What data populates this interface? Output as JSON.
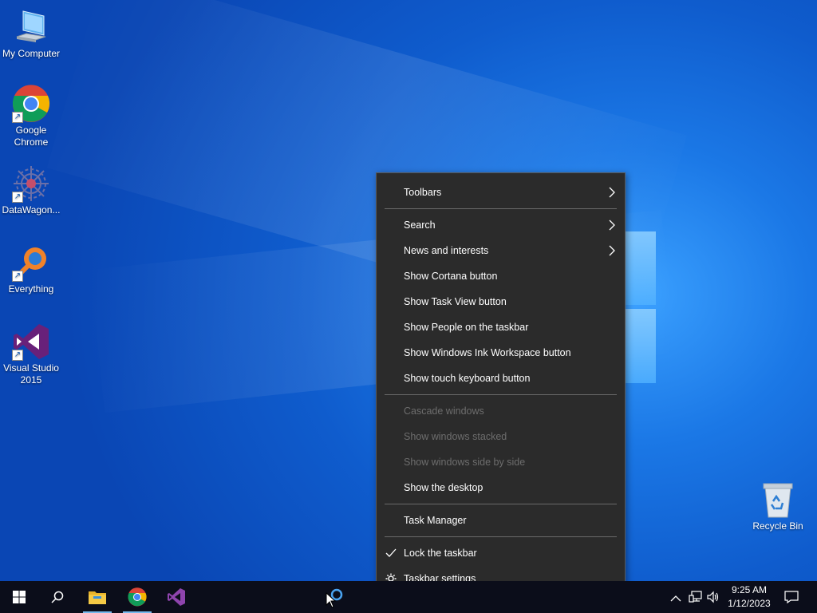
{
  "desktop": {
    "icons": [
      {
        "label": "My Computer",
        "icon": "computer-icon"
      },
      {
        "label": "Google Chrome",
        "icon": "chrome-icon"
      },
      {
        "label": "DataWagon...",
        "icon": "datawagon-icon"
      },
      {
        "label": "Everything",
        "icon": "everything-search-icon"
      },
      {
        "label": "Visual Studio 2015",
        "icon": "visual-studio-icon"
      },
      {
        "label": "Recycle Bin",
        "icon": "recycle-bin-icon"
      }
    ]
  },
  "context_menu": {
    "items": [
      {
        "label": "Toolbars",
        "submenu": true
      },
      {
        "label": "Search",
        "submenu": true
      },
      {
        "label": "News and interests",
        "submenu": true
      },
      {
        "label": "Show Cortana button"
      },
      {
        "label": "Show Task View button"
      },
      {
        "label": "Show People on the taskbar"
      },
      {
        "label": "Show Windows Ink Workspace button"
      },
      {
        "label": "Show touch keyboard button"
      },
      {
        "label": "Cascade windows",
        "disabled": true
      },
      {
        "label": "Show windows stacked",
        "disabled": true
      },
      {
        "label": "Show windows side by side",
        "disabled": true
      },
      {
        "label": "Show the desktop"
      },
      {
        "label": "Task Manager"
      },
      {
        "label": "Lock the taskbar",
        "checked": true
      },
      {
        "label": "Taskbar settings",
        "icon": "gear-icon"
      }
    ]
  },
  "taskbar": {
    "buttons": [
      "start-icon",
      "search-icon",
      "file-explorer-icon",
      "chrome-icon",
      "visual-studio-icon",
      "cortana-icon"
    ],
    "tray": [
      "chevron-up-icon",
      "network-icon",
      "volume-icon",
      "notifications-icon"
    ],
    "clock": {
      "time": "9:25 AM",
      "date": "1/12/2023"
    }
  },
  "colors": {
    "menu_bg": "#2b2b2b",
    "menu_text": "#ffffff",
    "menu_disabled": "#6d6d6d",
    "taskbar_bg": "#0b0d1a",
    "desktop_accent": "#1b78e6"
  }
}
